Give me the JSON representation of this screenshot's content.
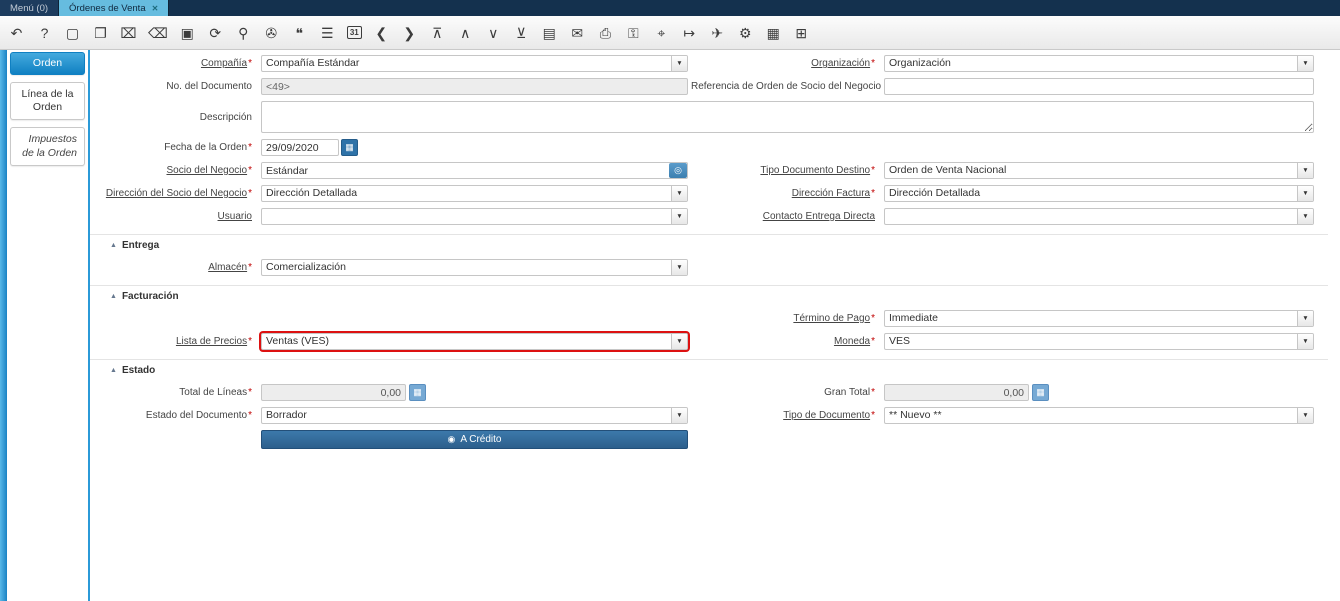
{
  "window": {
    "menu_tab": "Menú (0)",
    "active_tab": "Órdenes de Venta",
    "close_icon": "✕"
  },
  "toolbar": {
    "icons": [
      {
        "name": "undo-icon",
        "glyph": "↶"
      },
      {
        "name": "help-icon",
        "glyph": "?"
      },
      {
        "name": "new-record-icon",
        "glyph": "▢"
      },
      {
        "name": "copy-record-icon",
        "glyph": "❐"
      },
      {
        "name": "delete-record-icon",
        "glyph": "⌧"
      },
      {
        "name": "ignore-changes-icon",
        "glyph": "⌫"
      },
      {
        "name": "save-icon",
        "glyph": "▣"
      },
      {
        "name": "refresh-icon",
        "glyph": "⟳"
      },
      {
        "name": "find-icon",
        "glyph": "⚲"
      },
      {
        "name": "attachment-icon",
        "glyph": "✇"
      },
      {
        "name": "chat-icon",
        "glyph": "❝"
      },
      {
        "name": "grid-toggle-icon",
        "glyph": "☰"
      },
      {
        "name": "calendar-icon",
        "glyph": "31"
      },
      {
        "name": "prev-record-icon",
        "glyph": "❮"
      },
      {
        "name": "next-record-icon",
        "glyph": "❯"
      },
      {
        "name": "first-record-icon",
        "glyph": "⊼"
      },
      {
        "name": "parent-record-icon",
        "glyph": "∧"
      },
      {
        "name": "detail-record-icon",
        "glyph": "∨"
      },
      {
        "name": "last-record-icon",
        "glyph": "⊻"
      },
      {
        "name": "form-view-icon",
        "glyph": "▤"
      },
      {
        "name": "email-icon",
        "glyph": "✉"
      },
      {
        "name": "print-icon",
        "glyph": "⎙"
      },
      {
        "name": "lock-icon",
        "glyph": "⚿"
      },
      {
        "name": "zoom-across-icon",
        "glyph": "⌖"
      },
      {
        "name": "workflow-icon",
        "glyph": "↦"
      },
      {
        "name": "request-icon",
        "glyph": "✈"
      },
      {
        "name": "preference-icon",
        "glyph": "⚙"
      },
      {
        "name": "report-icon",
        "glyph": "▦"
      },
      {
        "name": "window-icon",
        "glyph": "⊞"
      }
    ]
  },
  "sidebar": {
    "tabs": [
      "Orden",
      "Línea de la Orden",
      "Impuestos de la Orden"
    ]
  },
  "form": {
    "required_marker": "*",
    "icons": {
      "dropdown": "▼",
      "calendar": "▦",
      "search": "◎",
      "calculator": "▦",
      "credit": "◉",
      "collapse": "▲"
    },
    "sections": {
      "entrega": "Entrega",
      "facturacion": "Facturación",
      "estado": "Estado"
    },
    "labels": {
      "compania": "Compañía",
      "organizacion": "Organización",
      "no_documento": "No. del Documento",
      "referencia": "Referencia de Orden de Socio del Negocio",
      "descripcion": "Descripción",
      "fecha": "Fecha de la Orden",
      "socio": "Socio del Negocio",
      "tipo_doc_destino": "Tipo Documento Destino",
      "dir_socio": "Dirección del Socio del Negocio",
      "dir_factura": "Dirección Factura",
      "usuario": "Usuario",
      "contacto": "Contacto Entrega Directa",
      "almacen": "Almacén",
      "termino_pago": "Término de Pago",
      "lista_precios": "Lista de Precios",
      "moneda": "Moneda",
      "total_lineas": "Total de Líneas",
      "gran_total": "Gran Total",
      "estado_doc": "Estado del Documento",
      "tipo_documento": "Tipo de Documento"
    },
    "values": {
      "compania": "Compañía Estándar",
      "organizacion": "Organización",
      "no_documento": "<49>",
      "referencia": "",
      "descripcion": "",
      "fecha": "29/09/2020",
      "socio": "Estándar",
      "tipo_doc_destino": "Orden de Venta Nacional",
      "dir_socio": "Dirección Detallada",
      "dir_factura": "Dirección Detallada",
      "usuario": "",
      "contacto": "",
      "almacen": "Comercialización",
      "termino_pago": "Immediate",
      "lista_precios": "Ventas (VES)",
      "moneda": "VES",
      "total_lineas": "0,00",
      "gran_total": "0,00",
      "estado_doc": "Borrador",
      "tipo_documento": "** Nuevo **"
    },
    "credito_label": "A Crédito"
  }
}
